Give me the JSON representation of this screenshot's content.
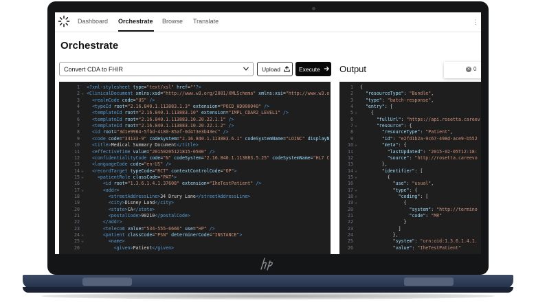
{
  "nav": {
    "items": [
      "Dashboard",
      "Orchestrate",
      "Browse",
      "Translate"
    ],
    "active": "Orchestrate",
    "kebab": "⋮"
  },
  "page": {
    "title": "Orchestrate"
  },
  "toolbar": {
    "select_value": "Convert CDA to FHIR",
    "upload_label": "Upload",
    "execute_label": "Execute"
  },
  "output": {
    "title": "Output",
    "error_count": "0"
  },
  "input_lines": [
    {
      "n": "1",
      "f": "",
      "h": "<span class=\"tag\">&lt;?xml-stylesheet</span> <span class=\"attr\">type</span>=<span class=\"str\">\"text/xsl\"</span> <span class=\"attr\">href</span>=<span class=\"str\">\"\"</span><span class=\"tag\">?&gt;</span>"
    },
    {
      "n": "2",
      "f": "⌄",
      "h": "<span class=\"tag\">&lt;ClinicalDocument</span> <span class=\"attr\">xmlns:xsd</span>=<span class=\"str\">\"http://www.w3.org/2001/XMLSchema\"</span> <span class=\"attr\">xmlns:xsi</span>=<span class=\"str\">\"http://www.w3.o</span>"
    },
    {
      "n": "3",
      "f": "",
      "h": "  <span class=\"tag\">&lt;realmCode</span> <span class=\"attr\">code</span>=<span class=\"str\">\"US\"</span> <span class=\"tag\">/&gt;</span>"
    },
    {
      "n": "4",
      "f": "",
      "h": "  <span class=\"tag\">&lt;typeId</span> <span class=\"attr\">root</span>=<span class=\"str\">\"2.16.840.1.113883.1.3\"</span> <span class=\"attr\">extension</span>=<span class=\"str\">\"POCD_HD000040\"</span> <span class=\"tag\">/&gt;</span>"
    },
    {
      "n": "5",
      "f": "",
      "h": "  <span class=\"tag\">&lt;templateId</span> <span class=\"attr\">root</span>=<span class=\"str\">\"2.16.840.1.113883.10\"</span> <span class=\"attr\">extension</span>=<span class=\"str\">\"IMPL_CDAR2_LEVEL1\"</span> <span class=\"tag\">/&gt;</span>"
    },
    {
      "n": "6",
      "f": "",
      "h": "  <span class=\"tag\">&lt;templateId</span> <span class=\"attr\">root</span>=<span class=\"str\">\"2.16.840.1.113883.10.20.22.1.1\"</span> <span class=\"tag\">/&gt;</span>"
    },
    {
      "n": "7",
      "f": "",
      "h": "  <span class=\"tag\">&lt;templateId</span> <span class=\"attr\">root</span>=<span class=\"str\">\"2.16.840.1.113883.10.20.22.1.2\"</span> <span class=\"tag\">/&gt;</span>"
    },
    {
      "n": "8",
      "f": "",
      "h": "  <span class=\"tag\">&lt;id</span> <span class=\"attr\">root</span>=<span class=\"str\">\"3d1e9964-5fbd-4180-85af-0d473e3b43ec\"</span> <span class=\"tag\">/&gt;</span>"
    },
    {
      "n": "9",
      "f": "",
      "h": "  <span class=\"tag\">&lt;code</span> <span class=\"attr\">code</span>=<span class=\"str\">\"34133-9\"</span> <span class=\"attr\">codeSystem</span>=<span class=\"str\">\"2.16.840.1.113883.6.1\"</span> <span class=\"attr\">codeSystemName</span>=<span class=\"str\">\"LOINC\"</span> <span class=\"attr\">displayN</span>"
    },
    {
      "n": "10",
      "f": "",
      "h": "  <span class=\"tag\">&lt;title&gt;</span>Medical Summary Document<span class=\"tag\">&lt;/title&gt;</span>"
    },
    {
      "n": "11",
      "f": "",
      "h": "  <span class=\"tag\">&lt;effectiveTime</span> <span class=\"attr\">value</span>=<span class=\"str\">\"20150205121815-0500\"</span> <span class=\"tag\">/&gt;</span>"
    },
    {
      "n": "12",
      "f": "",
      "h": "  <span class=\"tag\">&lt;confidentialityCode</span> <span class=\"attr\">code</span>=<span class=\"str\">\"N\"</span> <span class=\"attr\">codeSystem</span>=<span class=\"str\">\"2.16.840.1.113883.5.25\"</span> <span class=\"attr\">codeSystemName</span>=<span class=\"str\">\"HL7 C</span>"
    },
    {
      "n": "13",
      "f": "",
      "h": "  <span class=\"tag\">&lt;languageCode</span> <span class=\"attr\">code</span>=<span class=\"str\">\"en-US\"</span> <span class=\"tag\">/&gt;</span>"
    },
    {
      "n": "14",
      "f": "⌄",
      "h": "  <span class=\"tag\">&lt;recordTarget</span> <span class=\"attr\">typeCode</span>=<span class=\"str\">\"RCT\"</span> <span class=\"attr\">contextControlCode</span>=<span class=\"str\">\"OP\"</span><span class=\"tag\">&gt;</span>"
    },
    {
      "n": "15",
      "f": "⌄",
      "h": "    <span class=\"tag\">&lt;patientRole</span> <span class=\"attr\">classCode</span>=<span class=\"str\">\"PAT\"</span><span class=\"tag\">&gt;</span>"
    },
    {
      "n": "16",
      "f": "",
      "h": "      <span class=\"tag\">&lt;id</span> <span class=\"attr\">root</span>=<span class=\"str\">\"1.3.6.1.4.1.37608\"</span> <span class=\"attr\">extension</span>=<span class=\"str\">\"IheTestPatient\"</span> <span class=\"tag\">/&gt;</span>"
    },
    {
      "n": "17",
      "f": "⌄",
      "h": "      <span class=\"tag\">&lt;addr&gt;</span>"
    },
    {
      "n": "18",
      "f": "",
      "h": "        <span class=\"tag\">&lt;streetAddressLine&gt;</span>34 Drury Lane<span class=\"tag\">&lt;/streetAddressLine&gt;</span>"
    },
    {
      "n": "19",
      "f": "",
      "h": "        <span class=\"tag\">&lt;city&gt;</span>Disney Land<span class=\"tag\">&lt;/city&gt;</span>"
    },
    {
      "n": "20",
      "f": "",
      "h": "        <span class=\"tag\">&lt;state&gt;</span>CA<span class=\"tag\">&lt;/state&gt;</span>"
    },
    {
      "n": "21",
      "f": "",
      "h": "        <span class=\"tag\">&lt;postalCode&gt;</span>90210<span class=\"tag\">&lt;/postalCode&gt;</span>"
    },
    {
      "n": "22",
      "f": "",
      "h": "      <span class=\"tag\">&lt;/addr&gt;</span>"
    },
    {
      "n": "23",
      "f": "",
      "h": "      <span class=\"tag\">&lt;telecom</span> <span class=\"attr\">value</span>=<span class=\"str\">\"534-555-6666\"</span> <span class=\"attr\">use</span>=<span class=\"str\">\"HP\"</span> <span class=\"tag\">/&gt;</span>"
    },
    {
      "n": "24",
      "f": "⌄",
      "h": "      <span class=\"tag\">&lt;patient</span> <span class=\"attr\">classCode</span>=<span class=\"str\">\"PSN\"</span> <span class=\"attr\">determinerCode</span>=<span class=\"str\">\"INSTANCE\"</span><span class=\"tag\">&gt;</span>"
    },
    {
      "n": "25",
      "f": "⌄",
      "h": "        <span class=\"tag\">&lt;name&gt;</span>"
    },
    {
      "n": "26",
      "f": "",
      "h": "          <span class=\"tag\">&lt;given&gt;</span>Patient<span class=\"tag\">&lt;/given&gt;</span>"
    }
  ],
  "output_lines": [
    {
      "n": "1",
      "f": "",
      "h": "{"
    },
    {
      "n": "2",
      "f": "",
      "h": "  <span class=\"k\">\"resourceType\"</span>: <span class=\"v\">\"Bundle\"</span>,"
    },
    {
      "n": "3",
      "f": "",
      "h": "  <span class=\"k\">\"type\"</span>: <span class=\"v\">\"batch-response\"</span>,"
    },
    {
      "n": "4",
      "f": "",
      "h": "  <span class=\"k\">\"entry\"</span>: ["
    },
    {
      "n": "5",
      "f": "⌄",
      "h": "    {"
    },
    {
      "n": "6",
      "f": "",
      "h": "      <span class=\"k\">\"fullUrl\"</span>: <span class=\"v\">\"https://api.rosetta.careev</span>"
    },
    {
      "n": "7",
      "f": "⌄",
      "h": "      <span class=\"k\">\"resource\"</span>: {"
    },
    {
      "n": "8",
      "f": "",
      "h": "        <span class=\"k\">\"resourceType\"</span>: <span class=\"v\">\"Patient\"</span>,"
    },
    {
      "n": "9",
      "f": "",
      "h": "        <span class=\"k\">\"id\"</span>: <span class=\"v\">\"e2fd1b2a-9c67-498d-ace9-b552</span>"
    },
    {
      "n": "10",
      "f": "⌄",
      "h": "        <span class=\"k\">\"meta\"</span>: {"
    },
    {
      "n": "11",
      "f": "",
      "h": "          <span class=\"k\">\"lastUpdated\"</span>: <span class=\"v\">\"2015-02-05T12:18:</span>"
    },
    {
      "n": "12",
      "f": "",
      "h": "          <span class=\"k\">\"source\"</span>: <span class=\"v\">\"http://rosetta.careevo</span>"
    },
    {
      "n": "13",
      "f": "",
      "h": "        },"
    },
    {
      "n": "14",
      "f": "⌄",
      "h": "        <span class=\"k\">\"identifier\"</span>: ["
    },
    {
      "n": "15",
      "f": "⌄",
      "h": "          {"
    },
    {
      "n": "16",
      "f": "",
      "h": "            <span class=\"k\">\"use\"</span>: <span class=\"v\">\"usual\"</span>,"
    },
    {
      "n": "17",
      "f": "⌄",
      "h": "            <span class=\"k\">\"type\"</span>: {"
    },
    {
      "n": "18",
      "f": "⌄",
      "h": "              <span class=\"k\">\"coding\"</span>: ["
    },
    {
      "n": "19",
      "f": "⌄",
      "h": "                {"
    },
    {
      "n": "20",
      "f": "",
      "h": "                  <span class=\"k\">\"system\"</span>: <span class=\"v\">\"http://termino</span>"
    },
    {
      "n": "21",
      "f": "",
      "h": "                  <span class=\"k\">\"code\"</span>: <span class=\"v\">\"MR\"</span>"
    },
    {
      "n": "22",
      "f": "",
      "h": "                }"
    },
    {
      "n": "23",
      "f": "",
      "h": "              ]"
    },
    {
      "n": "24",
      "f": "",
      "h": "            },"
    },
    {
      "n": "25",
      "f": "",
      "h": "            <span class=\"k\">\"system\"</span>: <span class=\"v\">\"urn:oid:1.3.6.1.4.1.</span>"
    },
    {
      "n": "26",
      "f": "",
      "h": "            <span class=\"k\">\"value\"</span>: <span class=\"v\">\"IheTestPatient\"</span>"
    }
  ]
}
